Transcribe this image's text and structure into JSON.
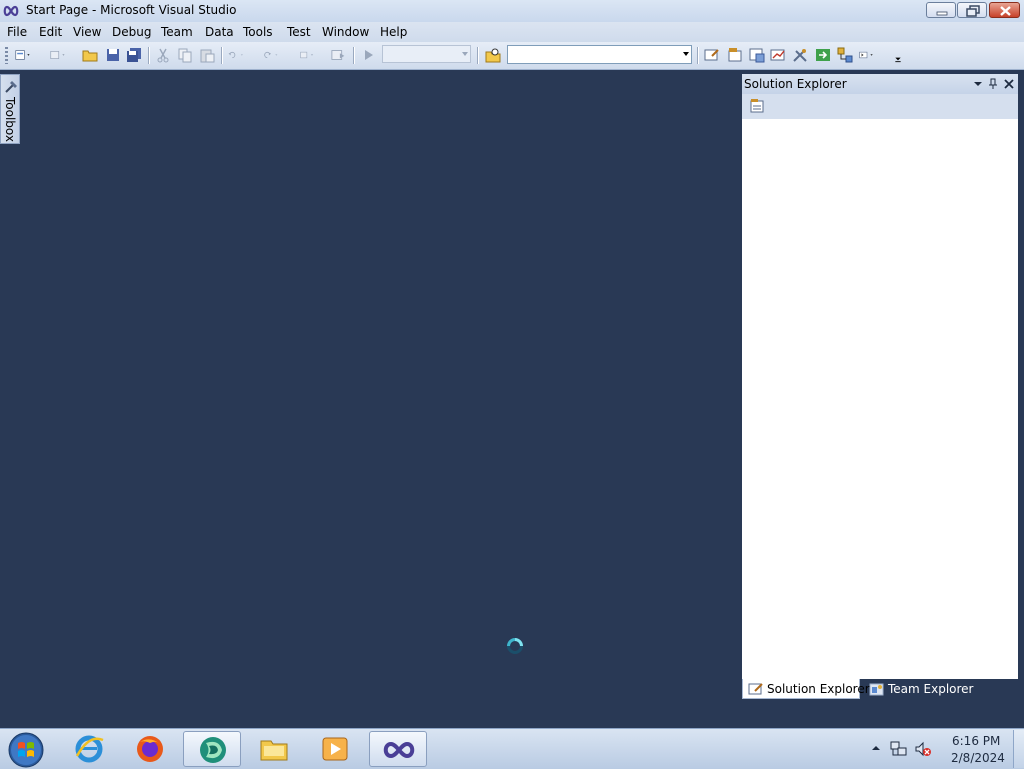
{
  "window": {
    "title": "Start Page - Microsoft Visual Studio",
    "app_icon": "visual-studio-infinity-icon",
    "controls": [
      "minimize-icon",
      "maximize-icon",
      "close-icon"
    ]
  },
  "menu": {
    "items": [
      "File",
      "Edit",
      "View",
      "Debug",
      "Team",
      "Data",
      "Tools",
      "Test",
      "Window",
      "Help"
    ]
  },
  "toolbar": {
    "solution_config": "",
    "find_box": "",
    "icons": [
      "new-project-icon",
      "add-item-icon",
      "open-file-icon",
      "save-icon",
      "save-all-icon",
      "cut-icon",
      "copy-icon",
      "paste-icon",
      "undo-icon",
      "redo-icon",
      "navigate-backward-icon",
      "navigate-forward-icon",
      "start-debugging-icon",
      "find-in-files-icon",
      "solution-explorer-icon",
      "properties-icon",
      "object-browser-icon",
      "toolbox-icon",
      "command-window-icon"
    ]
  },
  "toolbox": {
    "label": "Toolbox"
  },
  "solution_explorer": {
    "title": "Solution Explorer",
    "tabs": [
      {
        "label": "Solution Explorer",
        "active": true
      },
      {
        "label": "Team Explorer",
        "active": false
      }
    ]
  },
  "status": {
    "loading": true
  },
  "taskbar": {
    "apps": [
      "internet-explorer-icon",
      "firefox-icon",
      "app-icon",
      "file-explorer-icon",
      "media-player-icon",
      "visual-studio-icon"
    ],
    "clock_time": "6:16 PM",
    "clock_date": "2/8/2024"
  },
  "colors": {
    "workspace": "#293955",
    "chrome": "#cfdbec",
    "accent": "#3c5ea0"
  }
}
